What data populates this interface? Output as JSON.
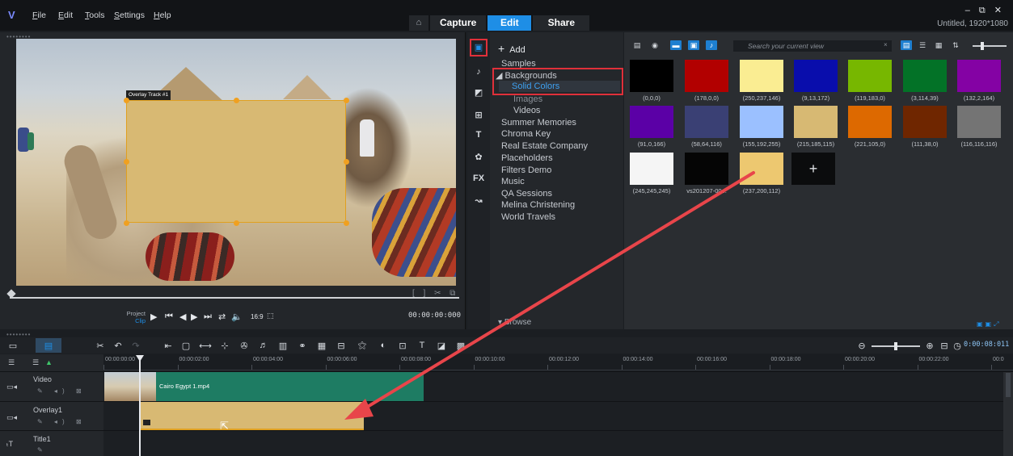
{
  "menubar": {
    "items": [
      "File",
      "Edit",
      "Tools",
      "Settings",
      "Help"
    ],
    "tabs": {
      "capture": "Capture",
      "edit": "Edit",
      "share": "Share"
    },
    "window_controls": "– ⧉ ✕",
    "project_title": "Untitled, 1920*1080"
  },
  "preview": {
    "overlay_label": "Overlay Track #1",
    "project_label": "Project",
    "clip_label": "Clip",
    "timecode": "00:00:00:000",
    "aspect": "16:9"
  },
  "library": {
    "add_label": "Add",
    "tree": [
      {
        "label": "Samples",
        "level": 0
      },
      {
        "label": "◢ Backgrounds",
        "level": 0
      },
      {
        "label": "Solid Colors",
        "level": 1
      },
      {
        "label": "Images",
        "level": 1
      },
      {
        "label": "Videos",
        "level": 1
      },
      {
        "label": "Summer Memories",
        "level": 0
      },
      {
        "label": "Chroma Key",
        "level": 0
      },
      {
        "label": "Real Estate Company",
        "level": 0
      },
      {
        "label": "Placeholders",
        "level": 0
      },
      {
        "label": "Filters Demo",
        "level": 0
      },
      {
        "label": "Music",
        "level": 0
      },
      {
        "label": "QA Sessions",
        "level": 0
      },
      {
        "label": "Melina Christening",
        "level": 0
      },
      {
        "label": "World Travels",
        "level": 0
      }
    ],
    "browse_label": "Browse",
    "search_placeholder": "Search your current view"
  },
  "swatches": [
    {
      "label": "(0,0,0)",
      "color": "#000000"
    },
    {
      "label": "(178,0,0)",
      "color": "#b20000"
    },
    {
      "label": "(250,237,146)",
      "color": "#faed92"
    },
    {
      "label": "(9,13,172)",
      "color": "#090dac"
    },
    {
      "label": "(119,183,0)",
      "color": "#77b700"
    },
    {
      "label": "(3,114,39)",
      "color": "#037227"
    },
    {
      "label": "(132,2,164)",
      "color": "#8402a4"
    },
    {
      "label": "(91,0,166)",
      "color": "#5b00a6"
    },
    {
      "label": "(58,64,116)",
      "color": "#3a4074"
    },
    {
      "label": "(155,192,255)",
      "color": "#9bc0ff"
    },
    {
      "label": "(215,185,115)",
      "color": "#d7b973"
    },
    {
      "label": "(221,105,0)",
      "color": "#dd6900"
    },
    {
      "label": "(111,38,0)",
      "color": "#6f2600"
    },
    {
      "label": "(116,116,116)",
      "color": "#747474"
    },
    {
      "label": "(245,245,245)",
      "color": "#f5f5f5"
    },
    {
      "label": "vs201207-00...",
      "color": "#050505"
    },
    {
      "label": "(237,200,112)",
      "color": "#edc870"
    }
  ],
  "add_swatch": "+",
  "timeline": {
    "timecode": "0:00:08:011",
    "ruler": [
      "00:00:00:00",
      "00:00:02:00",
      "00:00:04:00",
      "00:00:06:00",
      "00:00:08:00",
      "00:00:10:00",
      "00:00:12:00",
      "00:00:14:00",
      "00:00:16:00",
      "00:00:18:00",
      "00:00:20:00",
      "00:00:22:00",
      "00:0"
    ],
    "tracks": [
      {
        "name": "Video"
      },
      {
        "name": "Overlay1"
      },
      {
        "name": "Title1"
      }
    ],
    "video_clip": "Cairo Egypt 1.mp4"
  },
  "colors": {
    "accent": "#1e8ee6",
    "annotation": "#e0303a",
    "overlay": "#d8b973"
  }
}
